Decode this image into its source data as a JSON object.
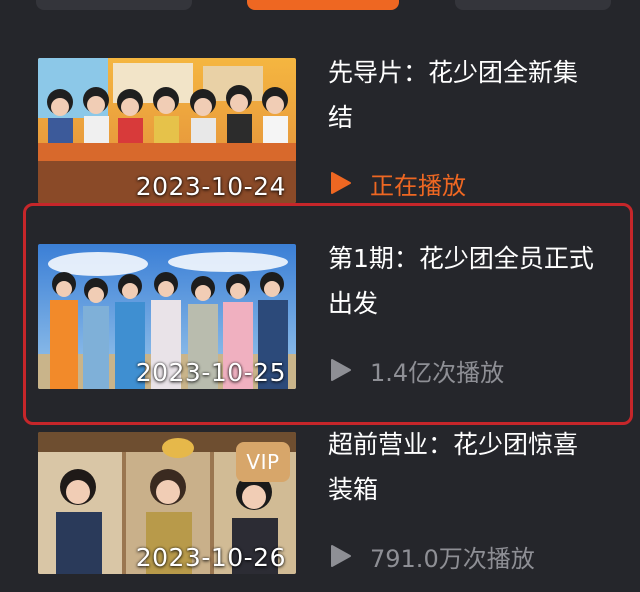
{
  "top_tabs": [
    {
      "label": ""
    },
    {
      "label": "",
      "active": true
    },
    {
      "label": ""
    }
  ],
  "episodes": [
    {
      "title_line1": "先导片：花少团全新集",
      "title_line2": "结",
      "date": "2023-10-24",
      "status": "正在播放",
      "status_kind": "playing",
      "vip": false
    },
    {
      "title_line1": "第1期：花少团全员正式",
      "title_line2": "出发",
      "date": "2023-10-25",
      "status": "1.4亿次播放",
      "status_kind": "count",
      "vip": false,
      "highlighted": true
    },
    {
      "title_line1": "超前营业：花少团惊喜",
      "title_line2": "装箱",
      "date": "2023-10-26",
      "status": "791.0万次播放",
      "status_kind": "count",
      "vip": true,
      "vip_label": "VIP"
    }
  ],
  "colors": {
    "background": "#25262b",
    "accent": "#ee6722",
    "muted": "#8e8f95",
    "highlight": "#c6262a",
    "vip": "#d7a66a"
  }
}
